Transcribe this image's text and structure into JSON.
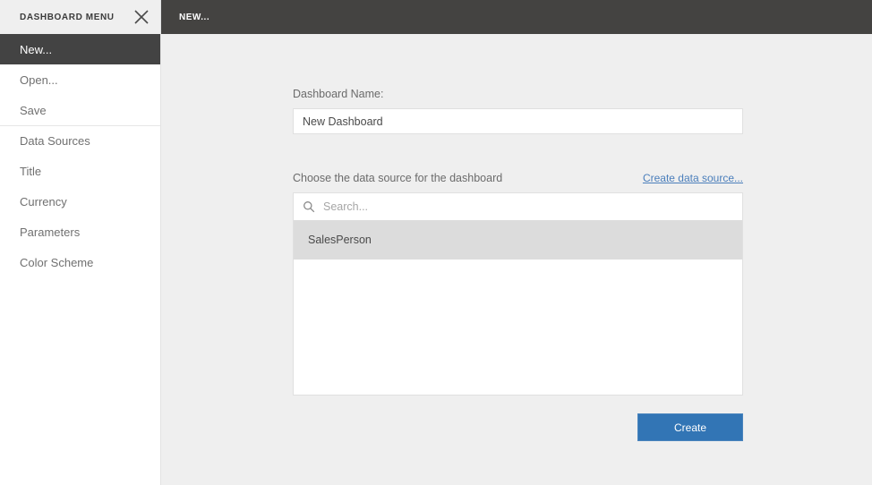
{
  "sidebar": {
    "title": "DASHBOARD MENU",
    "close_icon": "close-icon",
    "items": [
      {
        "label": "New...",
        "active": true,
        "divider": false
      },
      {
        "label": "Open...",
        "active": false,
        "divider": false
      },
      {
        "label": "Save",
        "active": false,
        "divider": false
      },
      {
        "label": "Data Sources",
        "active": false,
        "divider": true
      },
      {
        "label": "Title",
        "active": false,
        "divider": false
      },
      {
        "label": "Currency",
        "active": false,
        "divider": false
      },
      {
        "label": "Parameters",
        "active": false,
        "divider": false
      },
      {
        "label": "Color Scheme",
        "active": false,
        "divider": false
      }
    ]
  },
  "topbar": {
    "tab_label": "NEW..."
  },
  "form": {
    "name_label": "Dashboard Name:",
    "name_value": "New Dashboard",
    "name_placeholder": "",
    "datasource_label": "Choose the data source for the dashboard",
    "create_datasource_link": "Create data source...",
    "search_placeholder": "Search...",
    "search_value": "",
    "search_icon": "search-icon",
    "datasources": [
      {
        "label": "SalesPerson",
        "selected": true
      }
    ],
    "create_button": "Create"
  },
  "colors": {
    "dark_chrome": "#444341",
    "sidebar_active": "#434343",
    "content_bg": "#efefef",
    "accent_blue": "#3275b5",
    "link_blue": "#4a7ebb",
    "selected_row": "#dcdcdc"
  }
}
